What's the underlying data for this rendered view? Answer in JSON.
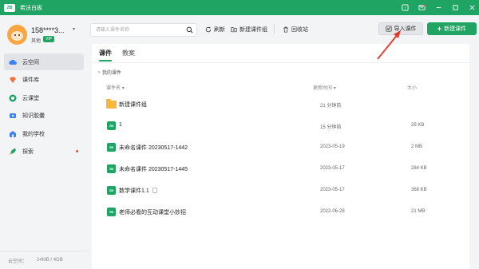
{
  "app": {
    "logo_text": "ZB",
    "title": "希沃白板"
  },
  "user": {
    "name": "158****3...",
    "role": "其他",
    "badge": "VIP"
  },
  "sidebar": {
    "items": [
      {
        "label": "云空间",
        "icon": "cloud-icon",
        "color": "#3b82f6",
        "active": true
      },
      {
        "label": "课件库",
        "icon": "diamond-icon",
        "color": "#f0743e"
      },
      {
        "label": "云课堂",
        "icon": "play-circle-icon",
        "color": "#1fa463"
      },
      {
        "label": "知识胶囊",
        "icon": "capsule-icon",
        "color": "#3b82f6"
      },
      {
        "label": "我的学校",
        "icon": "school-icon",
        "color": "#3b82f6"
      },
      {
        "label": "探索",
        "icon": "rocket-icon",
        "color": "#1fa463",
        "dot": true
      }
    ]
  },
  "storage": {
    "label": "云空间：",
    "value": "24MB / 4GB"
  },
  "toolbar": {
    "search_placeholder": "请输入课件名称",
    "refresh_label": "刷新",
    "new_group_label": "新建课件组",
    "recycle_label": "回收站",
    "import_label": "导入课件",
    "new_label": "新建课件"
  },
  "tabs": [
    {
      "label": "课件"
    },
    {
      "label": "教案"
    }
  ],
  "breadcrumb": "我的课件",
  "table": {
    "headers": {
      "name": "课件名",
      "time": "更新时间",
      "size": "大小"
    },
    "rows": [
      {
        "name": "新建课件组",
        "time": "21 分钟前",
        "size": "",
        "type": "folder"
      },
      {
        "name": "1",
        "time": "15 分钟前",
        "size": "29 KB",
        "type": "doc"
      },
      {
        "name": "未命名课件 20230517-1442",
        "time": "2023-05-19",
        "size": "2 MB",
        "type": "doc"
      },
      {
        "name": "未命名课件 20230517-1445",
        "time": "2023-05-17",
        "size": "284 KB",
        "type": "doc"
      },
      {
        "name": "数学课件1.1",
        "time": "2023-05-17",
        "size": "368 KB",
        "type": "doc",
        "tag": true
      },
      {
        "name": "老师必看的互动课堂小妙招",
        "time": "2022-06-28",
        "size": "21 MB",
        "type": "doc"
      }
    ]
  },
  "colors": {
    "brand": "#1fa463",
    "annotation": "#e23b2e"
  }
}
